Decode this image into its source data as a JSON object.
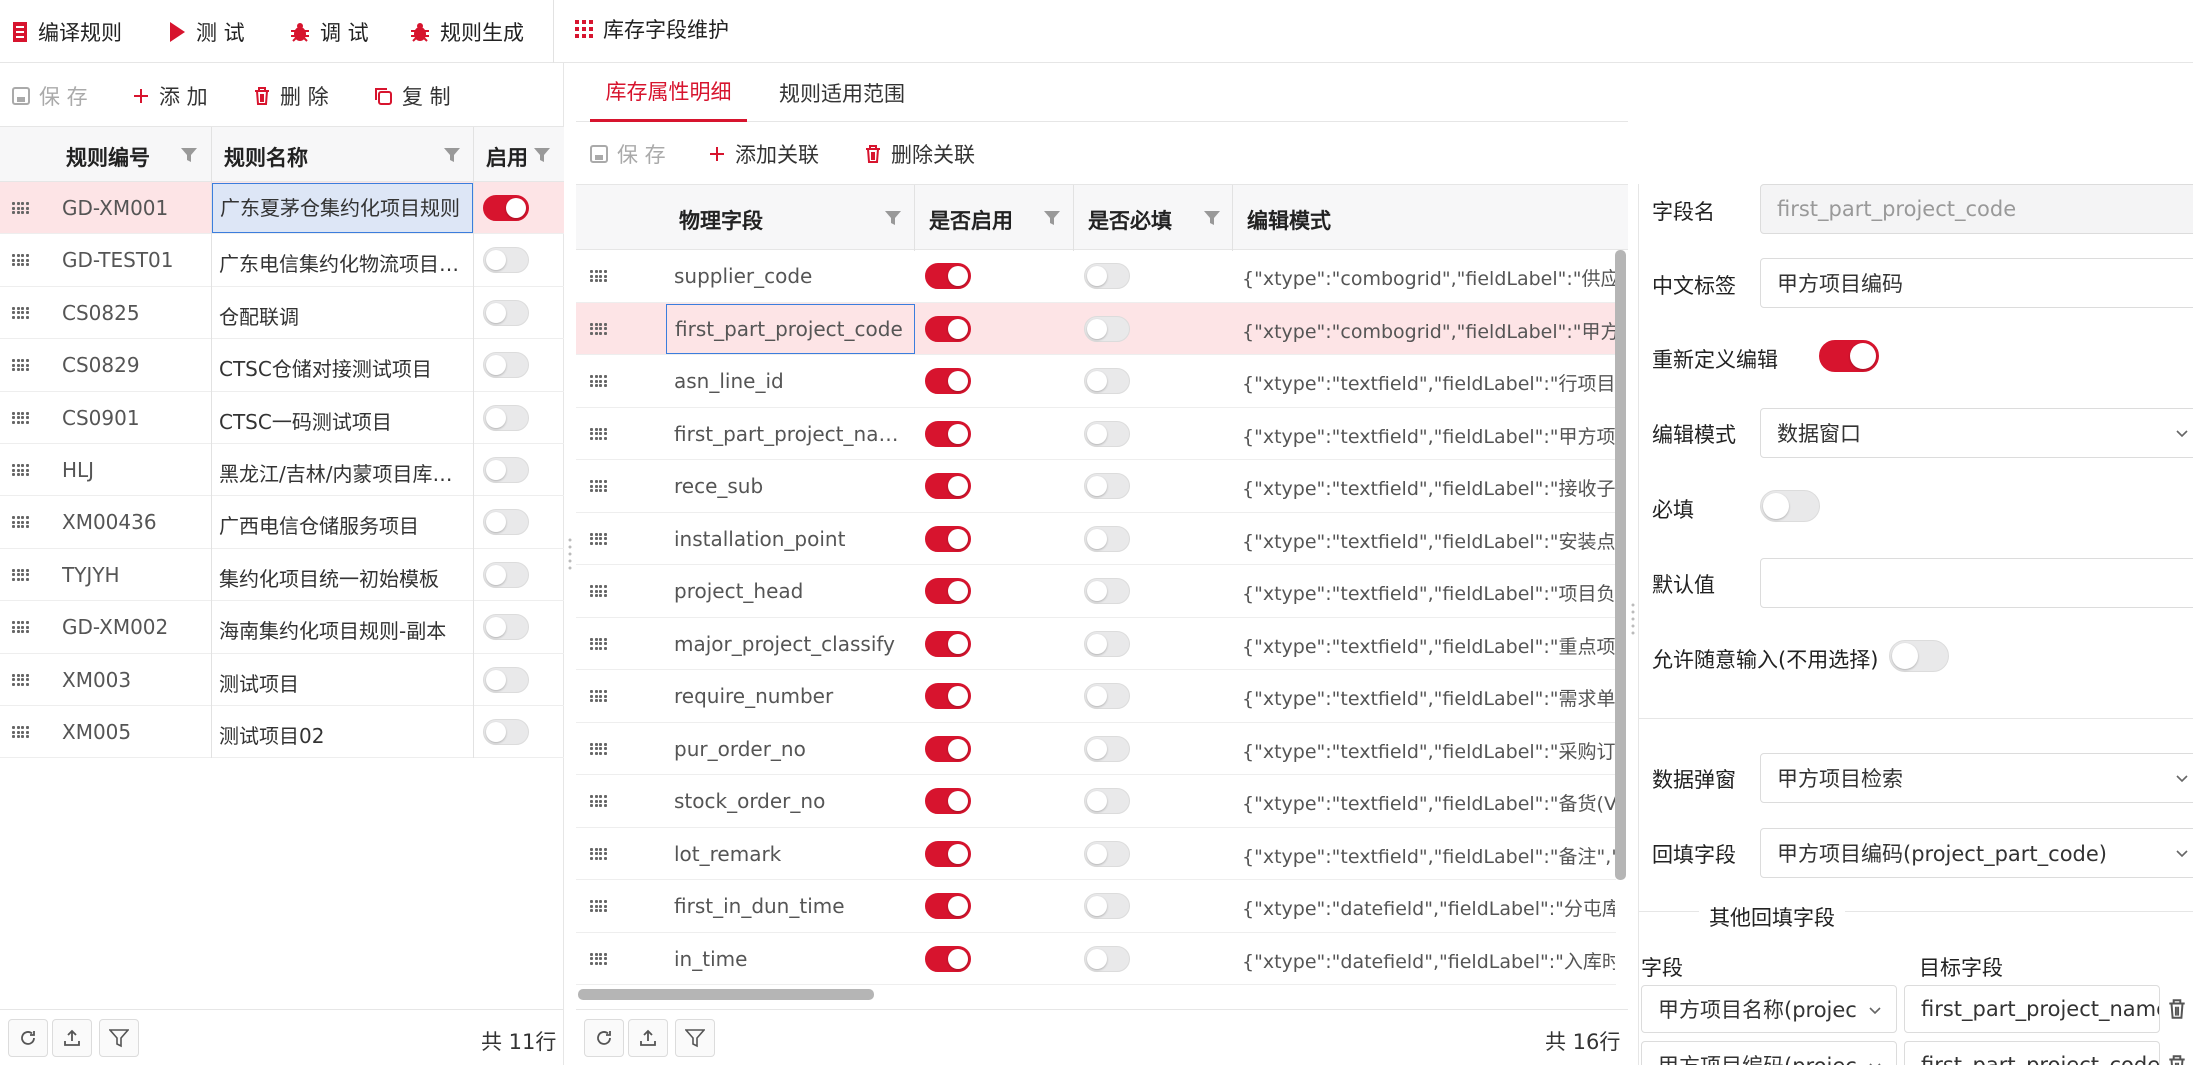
{
  "topbar": {
    "compile_rules": "编译规则",
    "test": "测 试",
    "debug": "调 试",
    "rule_gen": "规则生成",
    "stock_field_maint": "库存字段维护"
  },
  "left": {
    "toolbar": {
      "save": "保 存",
      "add": "添 加",
      "delete": "删 除",
      "copy": "复 制"
    },
    "columns": {
      "code": "规则编号",
      "name": "规则名称",
      "enabled": "启用"
    },
    "rows": [
      {
        "code": "GD-XM001",
        "name": "广东夏茅仓集约化项目规则",
        "enabled": true
      },
      {
        "code": "GD-TEST01",
        "name": "广东电信集约化物流项目规则",
        "enabled": false
      },
      {
        "code": "CS0825",
        "name": "仓配联调",
        "enabled": false
      },
      {
        "code": "CS0829",
        "name": "CTSC仓储对接测试项目",
        "enabled": false
      },
      {
        "code": "CS0901",
        "name": "CTSC一码测试项目",
        "enabled": false
      },
      {
        "code": "HLJ",
        "name": "黑龙江/吉林/内蒙项目库存规则",
        "enabled": false
      },
      {
        "code": "XM00436",
        "name": "广西电信仓储服务项目",
        "enabled": false
      },
      {
        "code": "TYJYH",
        "name": "集约化项目统一初始模板",
        "enabled": false
      },
      {
        "code": "GD-XM002",
        "name": "海南集约化项目规则-副本",
        "enabled": false
      },
      {
        "code": "XM003",
        "name": "测试项目",
        "enabled": false
      },
      {
        "code": "XM005",
        "name": "测试项目02",
        "enabled": false
      }
    ],
    "footer_count": "共 11行"
  },
  "middle": {
    "tabs": [
      "库存属性明细",
      "规则适用范围"
    ],
    "toolbar": {
      "save": "保 存",
      "add_link": "添加关联",
      "del_link": "删除关联"
    },
    "columns": {
      "field": "物理字段",
      "enabled": "是否启用",
      "required": "是否必填",
      "edit_mode": "编辑模式"
    },
    "rows": [
      {
        "field": "supplier_code",
        "enabled": true,
        "required": false,
        "edit": "{\"xtype\":\"combogrid\",\"fieldLabel\":\"供应商编"
      },
      {
        "field": "first_part_project_code",
        "enabled": true,
        "required": false,
        "edit": "{\"xtype\":\"combogrid\",\"fieldLabel\":\"甲方项目"
      },
      {
        "field": "asn_line_id",
        "enabled": true,
        "required": false,
        "edit": "{\"xtype\":\"textfield\",\"fieldLabel\":\"行项目编号"
      },
      {
        "field": "first_part_project_name",
        "enabled": true,
        "required": false,
        "edit": "{\"xtype\":\"textfield\",\"fieldLabel\":\"甲方项目名"
      },
      {
        "field": "rece_sub",
        "enabled": true,
        "required": false,
        "edit": "{\"xtype\":\"textfield\",\"fieldLabel\":\"接收子库\",\""
      },
      {
        "field": "installation_point",
        "enabled": true,
        "required": false,
        "edit": "{\"xtype\":\"textfield\",\"fieldLabel\":\"安装点\",\"ed"
      },
      {
        "field": "project_head",
        "enabled": true,
        "required": false,
        "edit": "{\"xtype\":\"textfield\",\"fieldLabel\":\"项目负责人"
      },
      {
        "field": "major_project_classify",
        "enabled": true,
        "required": false,
        "edit": "{\"xtype\":\"textfield\",\"fieldLabel\":\"重点项目分"
      },
      {
        "field": "require_number",
        "enabled": true,
        "required": false,
        "edit": "{\"xtype\":\"textfield\",\"fieldLabel\":\"需求单号\",\""
      },
      {
        "field": "pur_order_no",
        "enabled": true,
        "required": false,
        "edit": "{\"xtype\":\"textfield\",\"fieldLabel\":\"采购订单号"
      },
      {
        "field": "stock_order_no",
        "enabled": true,
        "required": false,
        "edit": "{\"xtype\":\"textfield\",\"fieldLabel\":\"备货(VMI)订"
      },
      {
        "field": "lot_remark",
        "enabled": true,
        "required": false,
        "edit": "{\"xtype\":\"textfield\",\"fieldLabel\":\"备注\",\"edita"
      },
      {
        "field": "first_in_dun_time",
        "enabled": true,
        "required": false,
        "edit": "{\"xtype\":\"datefield\",\"fieldLabel\":\"分屯库首次"
      },
      {
        "field": "in_time",
        "enabled": true,
        "required": false,
        "edit": "{\"xtype\":\"datefield\",\"fieldLabel\":\"入库时间\","
      }
    ],
    "footer_count": "共 16行"
  },
  "right": {
    "field_name_label": "字段名",
    "field_name_value": "first_part_project_code",
    "cn_label_label": "中文标签",
    "cn_label_value": "甲方项目编码",
    "redefine_label": "重新定义编辑",
    "redefine_on": true,
    "edit_mode_label": "编辑模式",
    "edit_mode_value": "数据窗口",
    "required_label": "必填",
    "required_on": false,
    "default_label": "默认值",
    "default_value": "",
    "free_input_label": "允许随意输入(不用选择)",
    "free_input_on": false,
    "popup_label": "数据弹窗",
    "popup_value": "甲方项目检索",
    "backfill_label": "回填字段",
    "backfill_value": "甲方项目编码(project_part_code)",
    "other_backfill_title": "其他回填字段",
    "col_field": "字段",
    "col_target": "目标字段",
    "other_rows": [
      {
        "field": "甲方项目名称(projec",
        "target": "first_part_project_name"
      },
      {
        "field": "甲方项目编码(projec",
        "target": "first_part_project_code"
      }
    ]
  },
  "colors": {
    "accent": "#d7142e",
    "selected_row": "#fde4e6"
  }
}
